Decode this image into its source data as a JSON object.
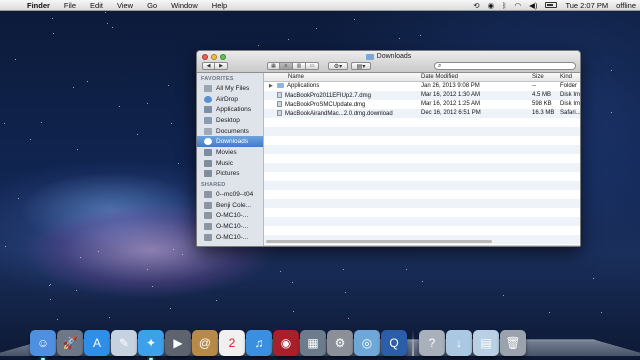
{
  "menubar": {
    "apple": "",
    "app": "Finder",
    "items": [
      "File",
      "Edit",
      "View",
      "Go",
      "Window",
      "Help"
    ],
    "status": {
      "clock": "Tue 2:07 PM",
      "user": "offline"
    }
  },
  "finder": {
    "title": "Downloads",
    "search_placeholder": "",
    "nav_back": "◀",
    "nav_forward": "▶",
    "sidebar": {
      "favorites_header": "FAVORITES",
      "favorites": [
        {
          "label": "All My Files",
          "icon": "all-files-icon",
          "color": "#9aa6b4"
        },
        {
          "label": "AirDrop",
          "icon": "airdrop-icon",
          "color": "#5a8fd0"
        },
        {
          "label": "Applications",
          "icon": "applications-icon",
          "color": "#7e8fa6"
        },
        {
          "label": "Desktop",
          "icon": "desktop-icon",
          "color": "#8a9ab0"
        },
        {
          "label": "Documents",
          "icon": "documents-icon",
          "color": "#a0a9b5"
        },
        {
          "label": "Downloads",
          "icon": "downloads-icon",
          "color": "#ffffff",
          "selected": true
        },
        {
          "label": "Movies",
          "icon": "movies-icon",
          "color": "#7f8c9b"
        },
        {
          "label": "Music",
          "icon": "music-icon",
          "color": "#7f8c9b"
        },
        {
          "label": "Pictures",
          "icon": "pictures-icon",
          "color": "#7f8c9b"
        }
      ],
      "shared_header": "SHARED",
      "shared": [
        {
          "label": "0--mc09--t04",
          "icon": "computer-icon"
        },
        {
          "label": "Benji Cole...",
          "icon": "computer-icon"
        },
        {
          "label": "O-MC10-...",
          "icon": "computer-icon"
        },
        {
          "label": "O-MC10-...",
          "icon": "computer-icon"
        },
        {
          "label": "O-MC10-...",
          "icon": "computer-icon"
        }
      ]
    },
    "columns": {
      "name": "Name",
      "date": "Date Modified",
      "size": "Size",
      "kind": "Kind"
    },
    "files": [
      {
        "name": "Applications",
        "date": "Jan 26, 2013 9:08 PM",
        "size": "--",
        "kind": "Folder",
        "type": "folder"
      },
      {
        "name": "MacBookPro2011EFIUp2.7.dmg",
        "date": "Mar 16, 2012 1:30 AM",
        "size": "4.5 MB",
        "kind": "Disk Im",
        "type": "file"
      },
      {
        "name": "MacBookProSMCUpdate.dmg",
        "date": "Mar 16, 2012 1:25 AM",
        "size": "598 KB",
        "kind": "Disk Im",
        "type": "file"
      },
      {
        "name": "MacBookAirandMac...2.0.dmg.download",
        "date": "Dec 16, 2012 6:51 PM",
        "size": "16.3 MB",
        "kind": "Safari...",
        "type": "file"
      }
    ]
  },
  "dock": {
    "items": [
      {
        "name": "finder-icon",
        "color": "#4f8fe0",
        "glyph": "☺",
        "running": true
      },
      {
        "name": "launchpad-icon",
        "color": "#6e7788",
        "glyph": "🚀"
      },
      {
        "name": "app-store-icon",
        "color": "#2f8fe8",
        "glyph": "A"
      },
      {
        "name": "preview-icon",
        "color": "#c7d2e0",
        "glyph": "✎"
      },
      {
        "name": "safari-icon",
        "color": "#3da0ea",
        "glyph": "✦",
        "running": true
      },
      {
        "name": "facetime-icon",
        "color": "#5d6470",
        "glyph": "▶"
      },
      {
        "name": "contacts-icon",
        "color": "#b88a4a",
        "glyph": "@"
      },
      {
        "name": "calendar-icon",
        "color": "#f0f0f0",
        "glyph": "2"
      },
      {
        "name": "itunes-icon",
        "color": "#3b8fe0",
        "glyph": "♫"
      },
      {
        "name": "photo-booth-icon",
        "color": "#a9202a",
        "glyph": "◉"
      },
      {
        "name": "iphoto-icon",
        "color": "#6c7c8c",
        "glyph": "▦"
      },
      {
        "name": "system-preferences-icon",
        "color": "#8a8f98",
        "glyph": "⚙"
      },
      {
        "name": "dvd-player-icon",
        "color": "#6ea8d8",
        "glyph": "◎"
      },
      {
        "name": "quicktime-icon",
        "color": "#2a5ea8",
        "glyph": "Q"
      },
      {
        "name": "help-icon",
        "color": "#a8b0bb",
        "glyph": "?"
      },
      {
        "name": "downloads-stack-icon",
        "color": "#aac8e2",
        "glyph": "↓"
      },
      {
        "name": "documents-stack-icon",
        "color": "#b8cfe4",
        "glyph": "▤"
      },
      {
        "name": "trash-icon",
        "color": "#9aa2ad",
        "glyph": "🗑"
      }
    ]
  }
}
